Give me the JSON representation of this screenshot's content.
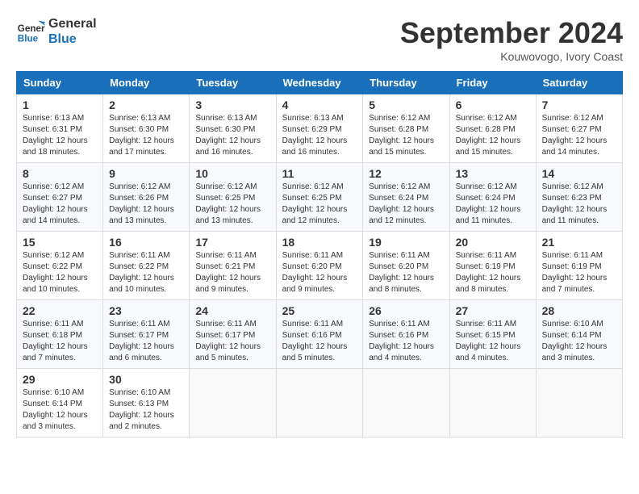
{
  "header": {
    "logo_line1": "General",
    "logo_line2": "Blue",
    "month_title": "September 2024",
    "subtitle": "Kouwovogo, Ivory Coast"
  },
  "weekdays": [
    "Sunday",
    "Monday",
    "Tuesday",
    "Wednesday",
    "Thursday",
    "Friday",
    "Saturday"
  ],
  "weeks": [
    [
      {
        "day": "1",
        "info": "Sunrise: 6:13 AM\nSunset: 6:31 PM\nDaylight: 12 hours\nand 18 minutes."
      },
      {
        "day": "2",
        "info": "Sunrise: 6:13 AM\nSunset: 6:30 PM\nDaylight: 12 hours\nand 17 minutes."
      },
      {
        "day": "3",
        "info": "Sunrise: 6:13 AM\nSunset: 6:30 PM\nDaylight: 12 hours\nand 16 minutes."
      },
      {
        "day": "4",
        "info": "Sunrise: 6:13 AM\nSunset: 6:29 PM\nDaylight: 12 hours\nand 16 minutes."
      },
      {
        "day": "5",
        "info": "Sunrise: 6:12 AM\nSunset: 6:28 PM\nDaylight: 12 hours\nand 15 minutes."
      },
      {
        "day": "6",
        "info": "Sunrise: 6:12 AM\nSunset: 6:28 PM\nDaylight: 12 hours\nand 15 minutes."
      },
      {
        "day": "7",
        "info": "Sunrise: 6:12 AM\nSunset: 6:27 PM\nDaylight: 12 hours\nand 14 minutes."
      }
    ],
    [
      {
        "day": "8",
        "info": "Sunrise: 6:12 AM\nSunset: 6:27 PM\nDaylight: 12 hours\nand 14 minutes."
      },
      {
        "day": "9",
        "info": "Sunrise: 6:12 AM\nSunset: 6:26 PM\nDaylight: 12 hours\nand 13 minutes."
      },
      {
        "day": "10",
        "info": "Sunrise: 6:12 AM\nSunset: 6:25 PM\nDaylight: 12 hours\nand 13 minutes."
      },
      {
        "day": "11",
        "info": "Sunrise: 6:12 AM\nSunset: 6:25 PM\nDaylight: 12 hours\nand 12 minutes."
      },
      {
        "day": "12",
        "info": "Sunrise: 6:12 AM\nSunset: 6:24 PM\nDaylight: 12 hours\nand 12 minutes."
      },
      {
        "day": "13",
        "info": "Sunrise: 6:12 AM\nSunset: 6:24 PM\nDaylight: 12 hours\nand 11 minutes."
      },
      {
        "day": "14",
        "info": "Sunrise: 6:12 AM\nSunset: 6:23 PM\nDaylight: 12 hours\nand 11 minutes."
      }
    ],
    [
      {
        "day": "15",
        "info": "Sunrise: 6:12 AM\nSunset: 6:22 PM\nDaylight: 12 hours\nand 10 minutes."
      },
      {
        "day": "16",
        "info": "Sunrise: 6:11 AM\nSunset: 6:22 PM\nDaylight: 12 hours\nand 10 minutes."
      },
      {
        "day": "17",
        "info": "Sunrise: 6:11 AM\nSunset: 6:21 PM\nDaylight: 12 hours\nand 9 minutes."
      },
      {
        "day": "18",
        "info": "Sunrise: 6:11 AM\nSunset: 6:20 PM\nDaylight: 12 hours\nand 9 minutes."
      },
      {
        "day": "19",
        "info": "Sunrise: 6:11 AM\nSunset: 6:20 PM\nDaylight: 12 hours\nand 8 minutes."
      },
      {
        "day": "20",
        "info": "Sunrise: 6:11 AM\nSunset: 6:19 PM\nDaylight: 12 hours\nand 8 minutes."
      },
      {
        "day": "21",
        "info": "Sunrise: 6:11 AM\nSunset: 6:19 PM\nDaylight: 12 hours\nand 7 minutes."
      }
    ],
    [
      {
        "day": "22",
        "info": "Sunrise: 6:11 AM\nSunset: 6:18 PM\nDaylight: 12 hours\nand 7 minutes."
      },
      {
        "day": "23",
        "info": "Sunrise: 6:11 AM\nSunset: 6:17 PM\nDaylight: 12 hours\nand 6 minutes."
      },
      {
        "day": "24",
        "info": "Sunrise: 6:11 AM\nSunset: 6:17 PM\nDaylight: 12 hours\nand 5 minutes."
      },
      {
        "day": "25",
        "info": "Sunrise: 6:11 AM\nSunset: 6:16 PM\nDaylight: 12 hours\nand 5 minutes."
      },
      {
        "day": "26",
        "info": "Sunrise: 6:11 AM\nSunset: 6:16 PM\nDaylight: 12 hours\nand 4 minutes."
      },
      {
        "day": "27",
        "info": "Sunrise: 6:11 AM\nSunset: 6:15 PM\nDaylight: 12 hours\nand 4 minutes."
      },
      {
        "day": "28",
        "info": "Sunrise: 6:10 AM\nSunset: 6:14 PM\nDaylight: 12 hours\nand 3 minutes."
      }
    ],
    [
      {
        "day": "29",
        "info": "Sunrise: 6:10 AM\nSunset: 6:14 PM\nDaylight: 12 hours\nand 3 minutes."
      },
      {
        "day": "30",
        "info": "Sunrise: 6:10 AM\nSunset: 6:13 PM\nDaylight: 12 hours\nand 2 minutes."
      },
      {
        "day": "",
        "info": ""
      },
      {
        "day": "",
        "info": ""
      },
      {
        "day": "",
        "info": ""
      },
      {
        "day": "",
        "info": ""
      },
      {
        "day": "",
        "info": ""
      }
    ]
  ]
}
